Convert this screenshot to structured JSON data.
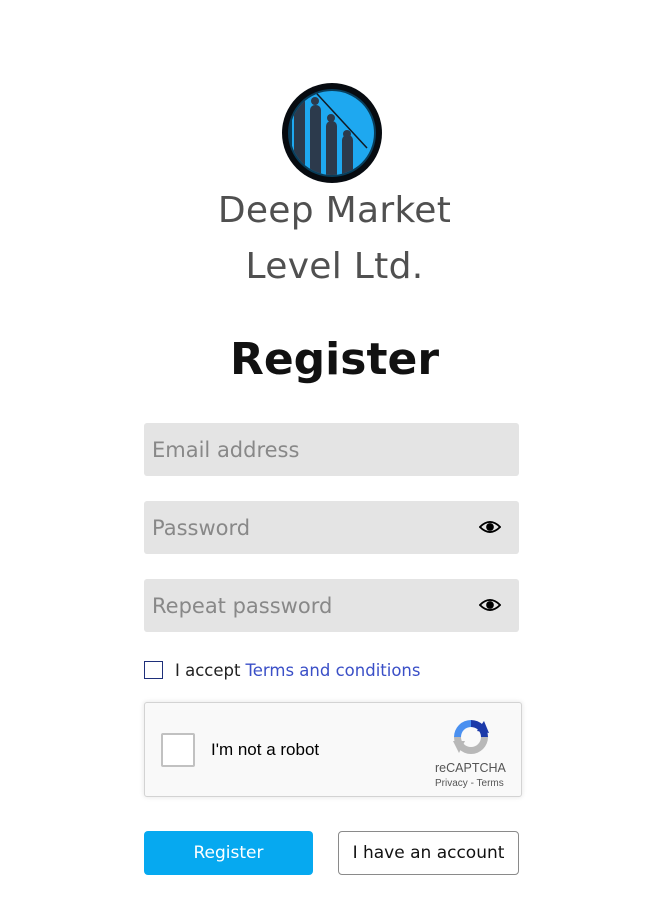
{
  "brand": {
    "name_line1": "Deep Market",
    "name_line2": "Level Ltd.",
    "logo_icon": "bar-chart-decline-logo",
    "accent_color": "#1ea8f0"
  },
  "form": {
    "title": "Register",
    "email": {
      "value": "",
      "placeholder": "Email address"
    },
    "password": {
      "value": "",
      "placeholder": "Password",
      "toggle_icon": "eye-icon"
    },
    "repeat_password": {
      "value": "",
      "placeholder": "Repeat password",
      "toggle_icon": "eye-icon"
    },
    "terms": {
      "checked": false,
      "prefix": "I accept",
      "link_text": "Terms and conditions"
    },
    "captcha": {
      "label": "I'm not a robot",
      "brand": "reCAPTCHA",
      "privacy": "Privacy",
      "separator": "-",
      "terms": "Terms"
    },
    "buttons": {
      "register": "Register",
      "have_account": "I have an account"
    }
  },
  "colors": {
    "primary_button": "#06a9f0",
    "link": "#3a4fc7",
    "input_bg": "#e4e4e4"
  }
}
